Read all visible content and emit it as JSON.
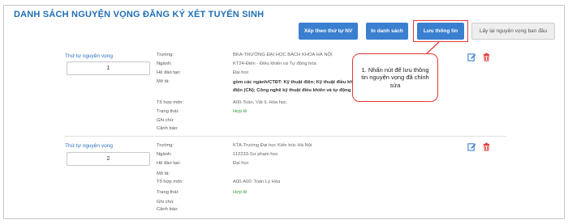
{
  "page": {
    "title": "DANH SÁCH NGUYỆN VỌNG ĐĂNG KÝ XÉT TUYỂN SINH"
  },
  "toolbar": {
    "sort_label": "Xếp theo thứ tự NV",
    "print_label": "In danh sách",
    "save_label": "Lưu thông tin",
    "restore_label": "Lấy lại nguyện vọng ban đầu"
  },
  "callout": {
    "text": "1. Nhấn nút để lưu thông tin nguyện vọng đã chỉnh sửa"
  },
  "colors": {
    "title": "#1f6eb5",
    "button": "#3a7fd0",
    "highlight": "#e03a3a",
    "status": "#2e9a35"
  },
  "icons": {
    "edit": "edit-icon",
    "delete": "trash-icon"
  },
  "records": [
    {
      "order_label": "Thứ tự nguyện vọng",
      "order_value": "1",
      "labels": {
        "school": "Trường:",
        "major": "Ngành:",
        "training": "Hệ đào tạo:",
        "desc": "Mô tả:",
        "combo": "Tổ hợp môn:",
        "status": "Trạng thái:",
        "note": "Ghi chú:",
        "warning": "Cảnh báo:"
      },
      "school": "BKA-TRƯỜNG ĐẠI HỌC BÁCH KHOA HÀ NỘI",
      "major": "KT24-Điện - Điều khiển và Tự động hóa",
      "training": "Đại học",
      "desc_line1": "gồm các ngành/CTĐT: Kỹ thuật điện; Kỹ thuật điều khiển",
      "desc_line2": "điện (CN); Công nghệ kỹ thuật điều khiển và tự động",
      "combo": "A00-Toán, Vật lí, Hóa học",
      "status": "Hợp lệ",
      "note": "",
      "warning": ""
    },
    {
      "order_label": "Thứ tự nguyện vọng",
      "order_value": "2",
      "labels": {
        "school": "Trường:",
        "major": "Ngành:",
        "training": "Hệ đào tạo:",
        "desc": "Mô tả:",
        "combo": "Tổ hợp môn:",
        "status": "Trạng thái:",
        "note": "Ghi chú:",
        "warning": "Cảnh báo:"
      },
      "school": "KTA-Trường Đại học Kiến trúc Hà Nội",
      "major": "112233-Sư phạm học",
      "training": "Đại học",
      "desc": "",
      "combo": "A00-A00: Toán Lý Hóa",
      "status": "Hợp lệ",
      "note": "",
      "warning": ""
    }
  ]
}
